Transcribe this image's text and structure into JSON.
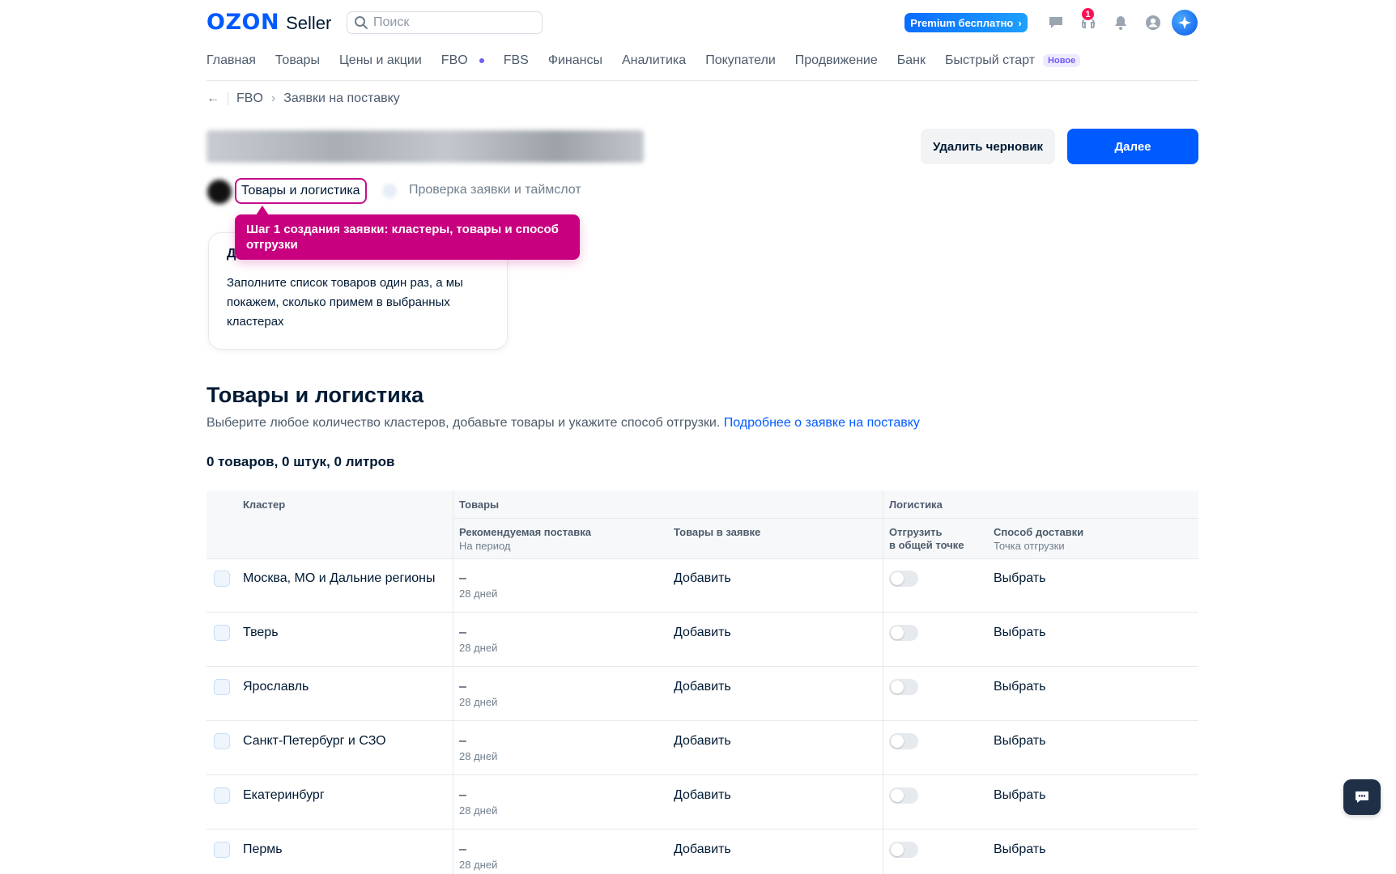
{
  "header": {
    "logo_brand": "OZON",
    "logo_product": "Seller",
    "search_placeholder": "Поиск",
    "premium_label": "Premium бесплатно",
    "support_badge": "1",
    "colors": {
      "brand": "#005bff",
      "highlight": "#c8007f",
      "badge": "#f91155"
    }
  },
  "nav": {
    "items": [
      "Главная",
      "Товары",
      "Цены и акции",
      "FBO",
      "FBS",
      "Финансы",
      "Аналитика",
      "Покупатели",
      "Продвижение",
      "Банк",
      "Быстрый старт"
    ],
    "new_badge": "Новое"
  },
  "breadcrumb": {
    "parent": "FBO",
    "current": "Заявки на поставку"
  },
  "actions": {
    "delete_draft": "Удалить черновик",
    "next": "Далее"
  },
  "stepper": {
    "step1": "Товары и логистика",
    "step2": "Проверка заявки и таймслот",
    "tooltip": "Шаг 1 создания заявки: кластеры, товары и способ отгрузки"
  },
  "info_card": {
    "title": "Д",
    "text": "Заполните список товаров один раз, а мы покажем, сколько примем в выбранных кластерах"
  },
  "section": {
    "title": "Товары и логистика",
    "description": "Выберите любое количество кластеров, добавьте товары и укажите способ отгрузки.",
    "link": "Подробнее о заявке на поставку",
    "counts": "0 товаров, 0 штук, 0 литров"
  },
  "table": {
    "headers": {
      "cluster": "Кластер",
      "goods": "Товары",
      "logistics": "Логистика",
      "recommended": "Рекомендуемая поставка",
      "recommended_sub": "На период",
      "in_request": "Товары в заявке",
      "ship_common_1": "Отгрузить",
      "ship_common_2": "в общей точке",
      "delivery": "Способ доставки",
      "delivery_sub": "Точка отгрузки"
    },
    "rows": [
      {
        "cluster": "Москва, МО и Дальние регионы",
        "rec": "–",
        "period": "28 дней",
        "add": "Добавить",
        "choose": "Выбрать"
      },
      {
        "cluster": "Тверь",
        "rec": "–",
        "period": "28 дней",
        "add": "Добавить",
        "choose": "Выбрать"
      },
      {
        "cluster": "Ярославль",
        "rec": "–",
        "period": "28 дней",
        "add": "Добавить",
        "choose": "Выбрать"
      },
      {
        "cluster": "Санкт-Петербург и СЗО",
        "rec": "–",
        "period": "28 дней",
        "add": "Добавить",
        "choose": "Выбрать"
      },
      {
        "cluster": "Екатеринбург",
        "rec": "–",
        "period": "28 дней",
        "add": "Добавить",
        "choose": "Выбрать"
      },
      {
        "cluster": "Пермь",
        "rec": "–",
        "period": "28 дней",
        "add": "Добавить",
        "choose": "Выбрать"
      }
    ]
  }
}
